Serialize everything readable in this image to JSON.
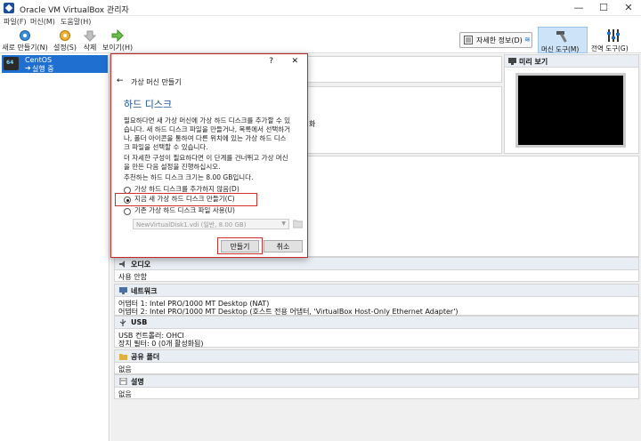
{
  "window": {
    "title": "Oracle VM VirtualBox 관리자",
    "minimize": "—",
    "maximize": "☐",
    "close": "✕"
  },
  "menu": [
    "파일(F)",
    "머신(M)",
    "도움말(H)"
  ],
  "toolbar": {
    "new": "새로 만들기(N)",
    "settings": "설정(S)",
    "discard": "삭제",
    "start": "보이기(H)",
    "detail": "자세한 정보(D)",
    "machine_tools": "머신 도구(M)",
    "global_tools": "전역 도구(G)"
  },
  "vm": {
    "name": "CentOS",
    "state": "실행 중"
  },
  "preview": {
    "title": "미리 보기"
  },
  "dialog": {
    "help": "?",
    "close": "✕",
    "back": "←",
    "header": "가상 머신 만들기",
    "section_title": "하드 디스크",
    "para1": [
      "필요하다면 새 가상 머신에 가상 하드 디스크를 추가할 수 있",
      "습니다. 새 하드 디스크 파일을 만들거나, 목록에서 선택하거",
      "나, 폴더 아이콘을 통하여 다른 위치에 있는 가상 하드 디스",
      "크 파일을 선택할 수 있습니다."
    ],
    "para2": [
      "더 자세한 구성이 필요하다면 이 단계를 건너뛰고 가상 머신",
      "을 만든 다음 설정을 진행하십시오."
    ],
    "recommend": "추천하는 하드 디스크 크기는 8.00 GB입니다.",
    "option_none": "가상 하드 디스크를 추가하지 않음(D)",
    "option_create": "지금 새 가상 하드 디스크 만들기(C)",
    "option_existing": "기존 가상 하드 디스크 파일 사용(U)",
    "disk_select": "NewVirtualDisk1.vdi (일반, 8.00 GB)",
    "create_button": "만들기",
    "cancel_button": "취소"
  },
  "sections": {
    "network_partial_text": "",
    "hidden_text": "화",
    "audio": {
      "title": "오디오",
      "value": "사용 안함"
    },
    "network": {
      "title": "네트워크",
      "rows": [
        "어댑터 1:  Intel PRO/1000 MT Desktop (NAT)",
        "어댑터 2:  Intel PRO/1000 MT Desktop (호스트 전용 어댑터, 'VirtualBox Host-Only Ethernet Adapter')"
      ]
    },
    "usb": {
      "title": "USB",
      "rows": [
        "USB 컨트롤러:   OHCI",
        "장치 필터:         0 (0개 활성화됨)"
      ]
    },
    "shared": {
      "title": "공유 폴더",
      "value": "없음"
    },
    "description": {
      "title": "설명",
      "value": "없음"
    }
  },
  "colors": {
    "accent": "#1f6fd0",
    "highlight": "#d32f2f"
  }
}
